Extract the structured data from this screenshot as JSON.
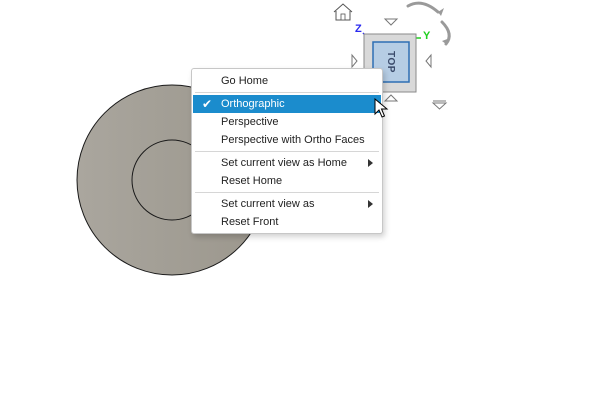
{
  "viewcube": {
    "face_label": "TOP",
    "axis_z": "Z",
    "axis_y": "Y"
  },
  "context_menu": {
    "items": [
      {
        "label": "Go Home",
        "checked": false,
        "submenu": false
      },
      {
        "label": "Orthographic",
        "checked": true,
        "submenu": false
      },
      {
        "label": "Perspective",
        "checked": false,
        "submenu": false
      },
      {
        "label": "Perspective with Ortho Faces",
        "checked": false,
        "submenu": false
      },
      {
        "label": "Set current view as Home",
        "checked": false,
        "submenu": true
      },
      {
        "label": "Reset Home",
        "checked": false,
        "submenu": false
      },
      {
        "label": "Set current view as",
        "checked": false,
        "submenu": true
      },
      {
        "label": "Reset Front",
        "checked": false,
        "submenu": false
      }
    ],
    "check_glyph": "✔"
  },
  "icons": {
    "home": "home-icon",
    "orbit": "orbit-arrows-icon",
    "cube_menu": "viewcube-menu-icon"
  },
  "colors": {
    "highlight": "#1b8ccd",
    "model_fill": "#a9a49b",
    "cube_face": "#b6cde4"
  }
}
